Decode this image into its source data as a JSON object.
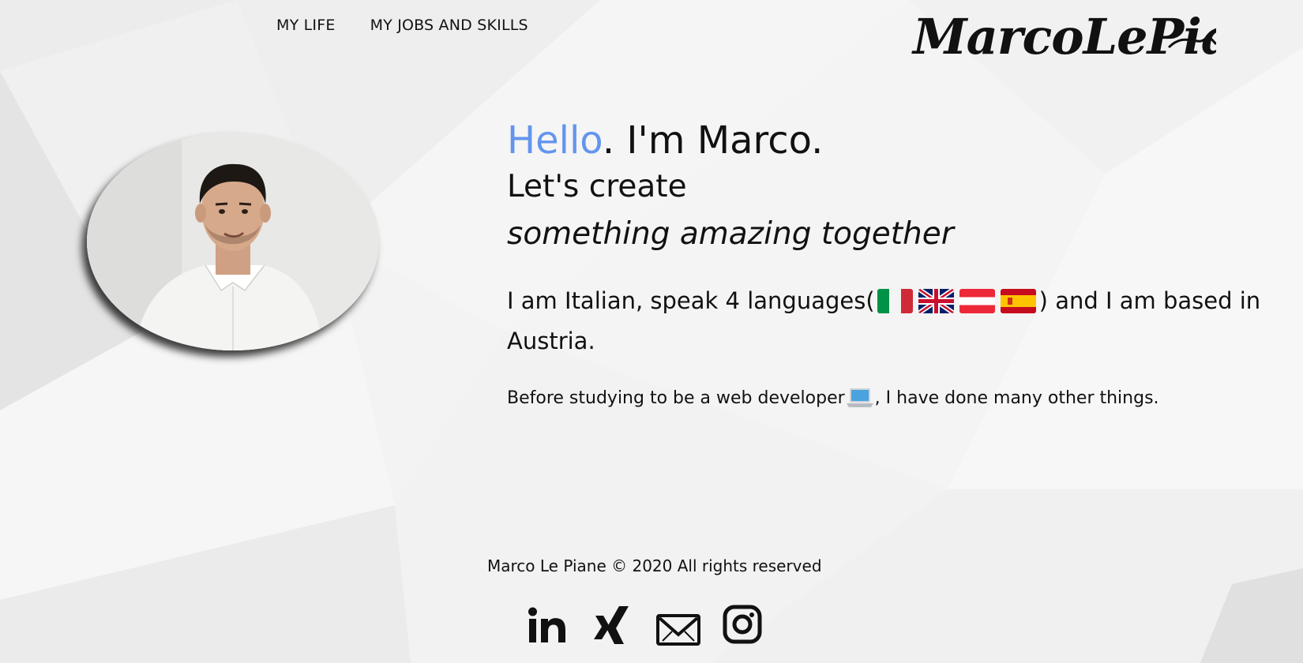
{
  "nav": {
    "items": [
      {
        "label": "MY LIFE"
      },
      {
        "label": "MY JOBS AND SKILLS"
      }
    ]
  },
  "logo": {
    "text": "MarcoLePiane"
  },
  "hero": {
    "hello_accent": "Hello",
    "hello_rest": ". I'm Marco.",
    "line2": "Let's create",
    "line3": "something amazing together",
    "languages_before": "I am Italian, speak 4 languages(",
    "languages_after": ") and I am based in Austria.",
    "flags": [
      "italy-flag",
      "uk-flag",
      "austria-flag",
      "spain-flag"
    ],
    "before_text_a": "Before studying to be a web developer",
    "before_text_b": ", I have done many other things.",
    "accent_color": "#6495ed"
  },
  "footer": {
    "copyright": "Marco Le Piane © 2020 All rights reserved",
    "socials": [
      {
        "icon": "linkedin-icon"
      },
      {
        "icon": "xing-icon"
      },
      {
        "icon": "mail-icon"
      },
      {
        "icon": "instagram-icon"
      }
    ]
  }
}
